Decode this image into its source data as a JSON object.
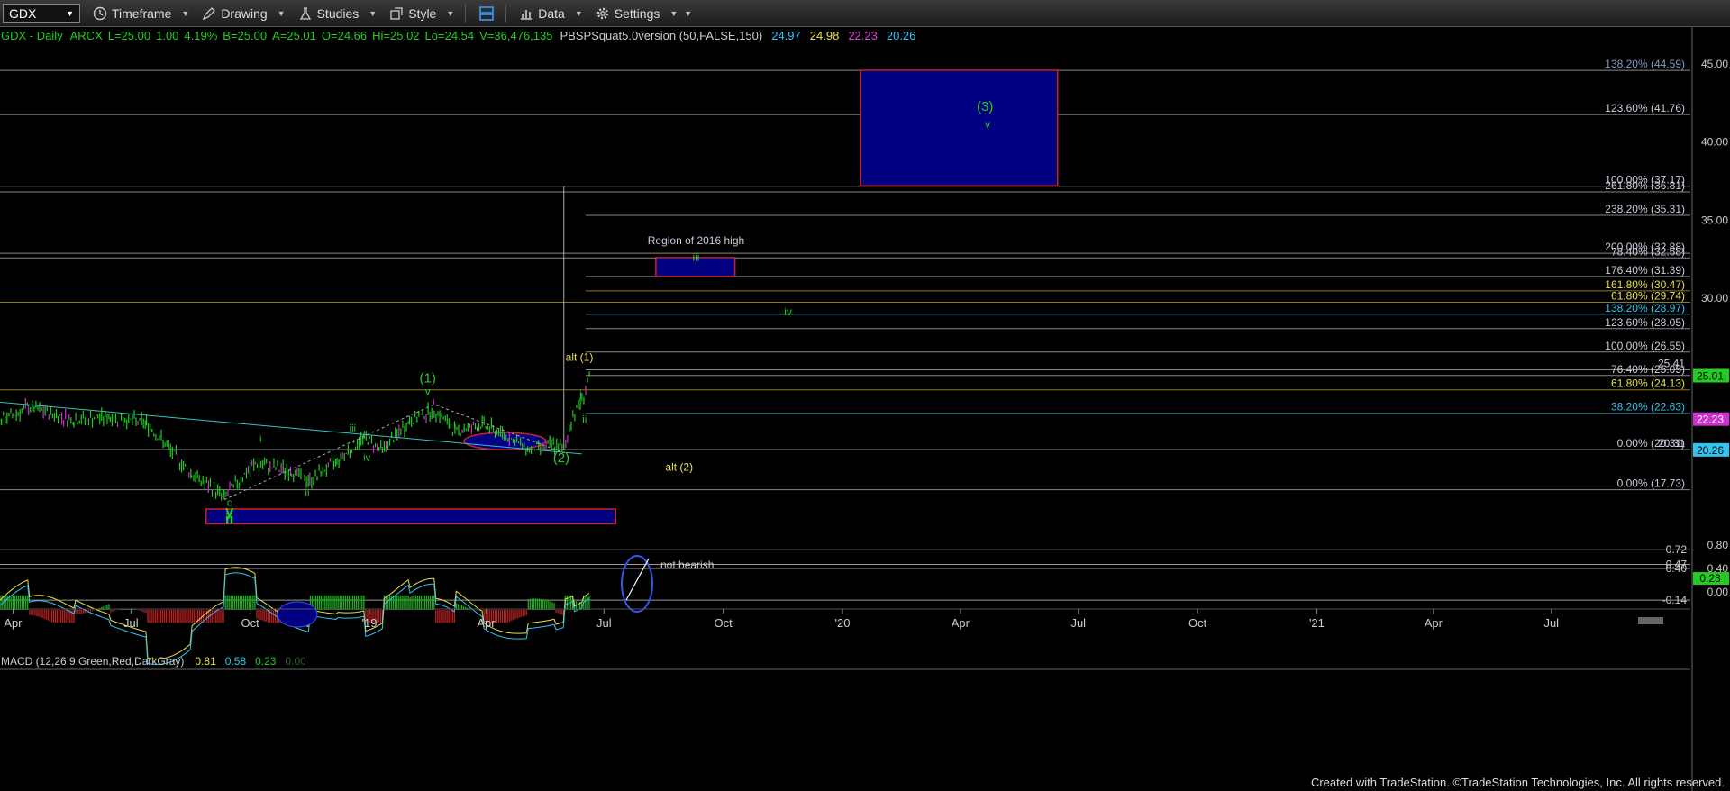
{
  "toolbar": {
    "symbol": "GDX",
    "timeframe": "Timeframe",
    "drawing": "Drawing",
    "studies": "Studies",
    "style": "Style",
    "data": "Data",
    "settings": "Settings"
  },
  "header": {
    "title": "GDX - Daily",
    "exchange": "ARCX",
    "last": "L=25.00",
    "change": "1.00",
    "change_pct": "4.19%",
    "bid": "B=25.00",
    "ask": "A=25.01",
    "open": "O=24.66",
    "high": "Hi=25.02",
    "low": "Lo=24.54",
    "volume": "V=36,476,135",
    "study": "PBSPSquat5.0version (50,FALSE,150)",
    "study_values": [
      {
        "text": "24.97",
        "color": "#33c3f0"
      },
      {
        "text": "24.98",
        "color": "#e8e050"
      },
      {
        "text": "22.23",
        "color": "#e040e0"
      },
      {
        "text": "20.26",
        "color": "#33c3f0"
      }
    ]
  },
  "macd_header": {
    "label": "MACD (12,26,9,Green,Red,DarkGray)",
    "values": [
      {
        "text": "0.81",
        "color": "#e8e050"
      },
      {
        "text": "0.58",
        "color": "#33c3f0"
      },
      {
        "text": "0.23",
        "color": "#22cc22"
      },
      {
        "text": "0.00",
        "color": "#226622"
      }
    ]
  },
  "footer": "Created with TradeStation. ©TradeStation Technologies, Inc. All rights reserved.",
  "chart_data": {
    "type": "candlestick",
    "symbol": "GDX",
    "interval": "Daily",
    "ylim": [
      15.5,
      46.5
    ],
    "y_ticks": [
      45.0,
      40.0,
      35.0,
      30.0
    ],
    "x_ticks": [
      "Apr",
      "Jul",
      "Oct",
      "'19",
      "Apr",
      "Jul",
      "Oct",
      "'20",
      "Apr",
      "Jul",
      "Oct",
      "'21",
      "Apr",
      "Jul"
    ],
    "price_path": [
      {
        "date": "2018-01-12",
        "price": 24.8
      },
      {
        "date": "2018-02-09",
        "price": 21.6
      },
      {
        "date": "2018-03-16",
        "price": 21.9
      },
      {
        "date": "2018-04-13",
        "price": 23.0
      },
      {
        "date": "2018-05-18",
        "price": 22.2
      },
      {
        "date": "2018-06-15",
        "price": 22.4
      },
      {
        "date": "2018-07-13",
        "price": 22.0
      },
      {
        "date": "2018-08-17",
        "price": 18.7
      },
      {
        "date": "2018-09-11",
        "price": 17.3
      },
      {
        "date": "2018-10-05",
        "price": 19.4
      },
      {
        "date": "2018-11-02",
        "price": 18.9
      },
      {
        "date": "2018-11-16",
        "price": 18.3
      },
      {
        "date": "2018-12-07",
        "price": 19.6
      },
      {
        "date": "2018-12-28",
        "price": 21.1
      },
      {
        "date": "2019-01-11",
        "price": 20.3
      },
      {
        "date": "2019-02-01",
        "price": 22.1
      },
      {
        "date": "2019-02-20",
        "price": 22.9
      },
      {
        "date": "2019-03-08",
        "price": 21.5
      },
      {
        "date": "2019-03-29",
        "price": 21.9
      },
      {
        "date": "2019-04-19",
        "price": 21.1
      },
      {
        "date": "2019-05-03",
        "price": 20.3
      },
      {
        "date": "2019-05-24",
        "price": 20.6
      },
      {
        "date": "2019-05-31",
        "price": 20.3
      },
      {
        "date": "2019-06-07",
        "price": 22.5
      },
      {
        "date": "2019-06-14",
        "price": 23.5
      },
      {
        "date": "2019-06-20",
        "price": 25.0
      }
    ],
    "last_price_tags": [
      {
        "text": "25.01",
        "value": 25.01,
        "bg": "#22cc22",
        "fg": "#000"
      },
      {
        "text": "22.23",
        "value": 22.23,
        "bg": "#d030d0",
        "fg": "#fff"
      },
      {
        "text": "20.26",
        "value": 20.26,
        "bg": "#33c3f0",
        "fg": "#000"
      }
    ],
    "fib_levels": [
      {
        "text": "138.20% (44.59)",
        "value": 44.59,
        "color": "#7f9fbf"
      },
      {
        "text": "123.60% (41.76)",
        "value": 41.76,
        "color": "#ccccdd"
      },
      {
        "text": "100.00% (37.17)",
        "value": 37.17,
        "color": "#ccccdd"
      },
      {
        "text": "261.80% (36.81)",
        "value": 36.81,
        "color": "#ccccdd"
      },
      {
        "text": "238.20% (35.31)",
        "value": 35.31,
        "color": "#ccccdd"
      },
      {
        "text": "200.00% (32.88)",
        "value": 32.88,
        "color": "#ccccdd"
      },
      {
        "text": "78.40% (32.58)",
        "value": 32.58,
        "color": "#ccccdd"
      },
      {
        "text": "176.40% (31.39)",
        "value": 31.39,
        "color": "#ccccdd"
      },
      {
        "text": "161.80% (30.47)",
        "value": 30.47,
        "color": "#e8e050"
      },
      {
        "text": "61.80% (29.74)",
        "value": 29.74,
        "color": "#e8e050"
      },
      {
        "text": "138.20% (28.97)",
        "value": 28.97,
        "color": "#33c3f0"
      },
      {
        "text": "123.60% (28.05)",
        "value": 28.05,
        "color": "#ccccdd"
      },
      {
        "text": "100.00% (26.55)",
        "value": 26.55,
        "color": "#ccccdd"
      },
      {
        "text": "25.41",
        "value": 25.41,
        "color": "#ccccdd"
      },
      {
        "text": "76.40% (25.05)",
        "value": 25.05,
        "color": "#ccccdd"
      },
      {
        "text": "61.80% (24.13)",
        "value": 24.13,
        "color": "#e8e050"
      },
      {
        "text": "38.20% (22.63)",
        "value": 22.63,
        "color": "#33c3f0"
      },
      {
        "text": "0.00% (20.31)",
        "value": 20.31,
        "color": "#ccccdd"
      },
      {
        "text": "20.31",
        "value": 20.31,
        "color": "#ccccdd"
      },
      {
        "text": "0.00% (17.73)",
        "value": 17.73,
        "color": "#ccccdd"
      }
    ],
    "wave_labels": [
      {
        "text": "(3)",
        "date": "2020-04-20",
        "price": 42.0,
        "color": "#22cc22",
        "size": 15
      },
      {
        "text": "v",
        "date": "2020-04-22",
        "price": 40.9,
        "color": "#22cc22",
        "size": 12
      },
      {
        "text": "Region of 2016 high",
        "date": "2019-09-10",
        "price": 33.45,
        "color": "#ccccdd",
        "size": 12
      },
      {
        "text": "iii",
        "date": "2019-09-10",
        "price": 32.4,
        "color": "#22cc22",
        "size": 12
      },
      {
        "text": "iv",
        "date": "2019-11-20",
        "price": 28.9,
        "color": "#22cc22",
        "size": 12
      },
      {
        "text": "alt (1)",
        "date": "2019-06-12",
        "price": 26.0,
        "color": "#e8e050",
        "size": 12
      },
      {
        "text": "(1)",
        "date": "2019-02-15",
        "price": 24.6,
        "color": "#22cc22",
        "size": 15
      },
      {
        "text": "v",
        "date": "2019-02-15",
        "price": 23.8,
        "color": "#22cc22",
        "size": 12
      },
      {
        "text": "i",
        "date": "2019-06-13",
        "price": 23.6,
        "color": "#22cc22",
        "size": 12
      },
      {
        "text": "ii",
        "date": "2019-06-16",
        "price": 22.0,
        "color": "#22cc22",
        "size": 12
      },
      {
        "text": "(2)",
        "date": "2019-05-29",
        "price": 19.5,
        "color": "#22cc22",
        "size": 15
      },
      {
        "text": "alt (2)",
        "date": "2019-08-28",
        "price": 18.95,
        "color": "#e8e050",
        "size": 12
      },
      {
        "text": "iii",
        "date": "2018-12-19",
        "price": 21.45,
        "color": "#22cc22",
        "size": 11
      },
      {
        "text": "iv",
        "date": "2018-12-30",
        "price": 19.6,
        "color": "#22cc22",
        "size": 11
      },
      {
        "text": "i",
        "date": "2018-10-09",
        "price": 20.8,
        "color": "#22cc22",
        "size": 11
      },
      {
        "text": "ii",
        "date": "2018-11-14",
        "price": 17.35,
        "color": "#22cc22",
        "size": 11
      },
      {
        "text": "c",
        "date": "2018-09-15",
        "price": 16.7,
        "color": "#22cc22",
        "size": 11
      },
      {
        "text": "y",
        "date": "2018-09-15",
        "price": 16.05,
        "color": "#22cc22",
        "size": 17
      },
      {
        "text": "ii",
        "date": "2018-09-15",
        "price": 15.55,
        "color": "#22cc22",
        "size": 17
      }
    ],
    "target_boxes": [
      {
        "name": "wave-3-target-box",
        "x0": "2020-01-15",
        "x1": "2020-06-15",
        "y0": 37.2,
        "y1": 44.6
      },
      {
        "name": "wave-iii-target-box",
        "x0": "2019-08-10",
        "x1": "2019-10-10",
        "y0": 31.4,
        "y1": 32.6
      },
      {
        "name": "wave-ii-support-box",
        "x0": "2018-08-28",
        "x1": "2019-07-10",
        "y0": 15.55,
        "y1": 16.5
      },
      {
        "name": "wave-2-ellipse",
        "x0": "2019-03-15",
        "x1": "2019-05-17",
        "y0": 20.3,
        "y1": 21.4
      }
    ],
    "trendline": {
      "d0": "2018-01-12",
      "p0": 23.85,
      "d1": "2019-05-31",
      "p1": 20.0
    },
    "macd": {
      "labels": [
        {
          "text": "0.72",
          "value": 0.72
        },
        {
          "text": "0.47",
          "value": 0.47
        },
        {
          "text": "0.40",
          "value": 0.4
        },
        {
          "text": "-0.14",
          "value": -0.14
        }
      ],
      "axis_ticks": [
        "0.80",
        "0.40",
        "0.00"
      ],
      "tag": {
        "text": "0.23",
        "value": 0.23
      },
      "annotation": "not bearish"
    }
  }
}
